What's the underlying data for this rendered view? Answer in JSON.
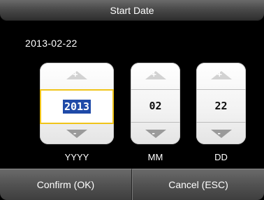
{
  "window": {
    "title": "Start Date"
  },
  "current_value": "2013-02-22",
  "spinners": {
    "year": {
      "value": "2013",
      "label": "YYYY",
      "up_icon": "+",
      "down_icon": "-"
    },
    "month": {
      "value": "02",
      "label": "MM",
      "up_icon": "+",
      "down_icon": "-"
    },
    "day": {
      "value": "22",
      "label": "DD",
      "up_icon": "+",
      "down_icon": "-"
    }
  },
  "footer": {
    "confirm_label": "Confirm (OK)",
    "cancel_label": "Cancel (ESC)"
  },
  "colors": {
    "background": "#000000",
    "focus_border": "#f0c419",
    "selection": "#1f4aa8"
  }
}
